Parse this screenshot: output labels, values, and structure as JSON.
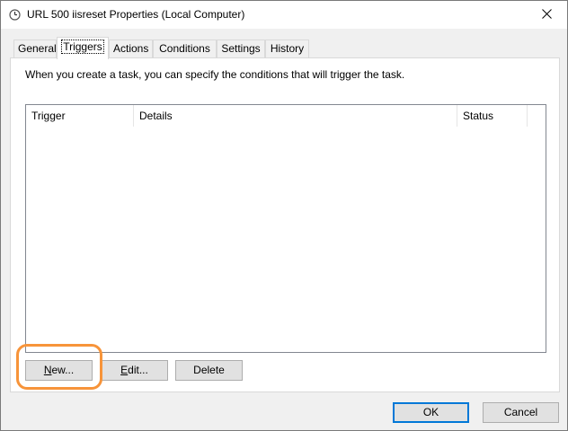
{
  "window": {
    "title": "URL 500 iisreset Properties (Local Computer)"
  },
  "tabs": [
    {
      "label": "General",
      "active": false
    },
    {
      "label": "Triggers",
      "active": true
    },
    {
      "label": "Actions",
      "active": false
    },
    {
      "label": "Conditions",
      "active": false
    },
    {
      "label": "Settings",
      "active": false
    },
    {
      "label": "History",
      "active": false
    }
  ],
  "triggers_panel": {
    "instruction": "When you create a task, you can specify the conditions that will trigger the task.",
    "columns": [
      "Trigger",
      "Details",
      "Status"
    ],
    "rows": [],
    "buttons": {
      "new": {
        "mnemonic": "N",
        "rest": "ew..."
      },
      "edit": {
        "mnemonic": "E",
        "rest": "dit..."
      },
      "delete": "Delete"
    }
  },
  "dialog_buttons": {
    "ok": "OK",
    "cancel": "Cancel"
  },
  "icons": {
    "title": "clock-icon",
    "close": "close-icon"
  },
  "colors": {
    "highlight": "#f7943a",
    "default_button_border": "#0078d7"
  }
}
